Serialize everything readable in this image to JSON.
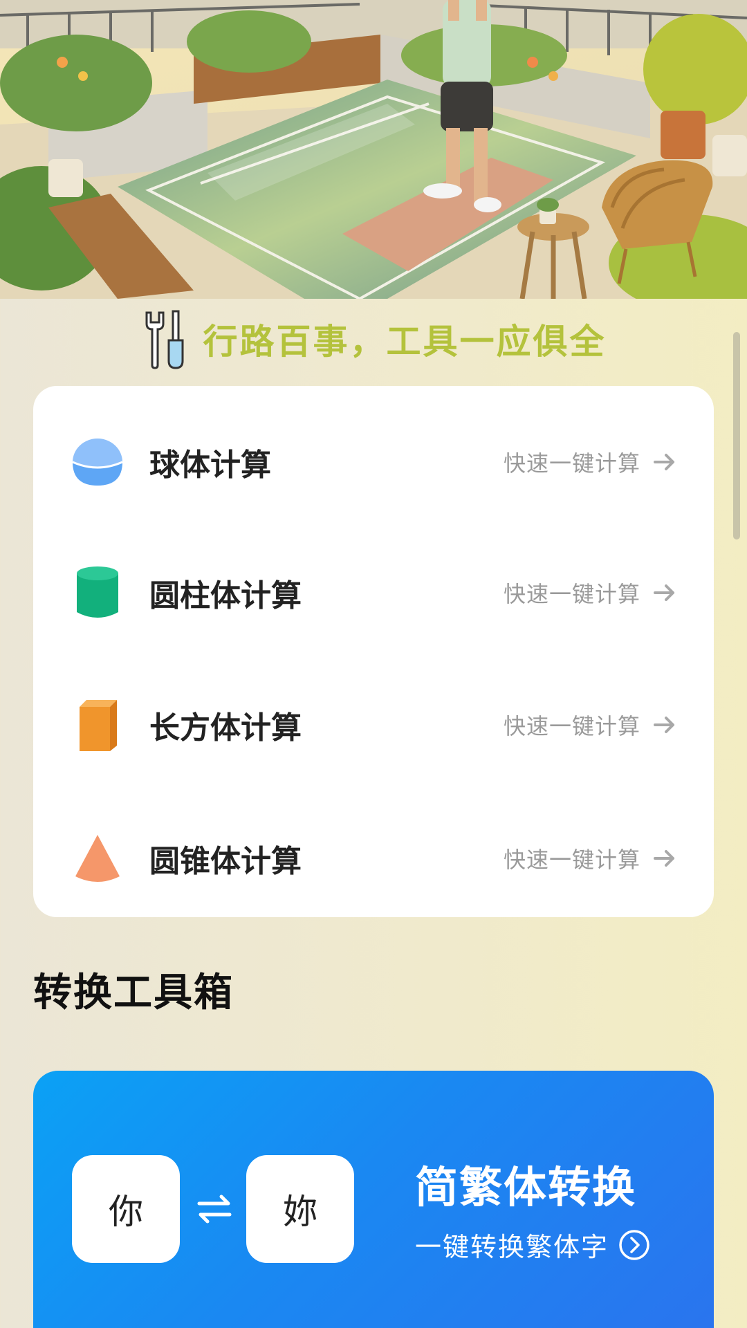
{
  "slogan": {
    "text": "行路百事，工具一应俱全",
    "icon": "tools-icon",
    "color": "#b4c23c"
  },
  "calculators": [
    {
      "title": "球体计算",
      "action": "快速一键计算",
      "icon": "sphere-icon",
      "color": "#6aaef7"
    },
    {
      "title": "圆柱体计算",
      "action": "快速一键计算",
      "icon": "cylinder-icon",
      "color": "#1cb37f"
    },
    {
      "title": "长方体计算",
      "action": "快速一键计算",
      "icon": "cuboid-icon",
      "color": "#f0952c"
    },
    {
      "title": "圆锥体计算",
      "action": "快速一键计算",
      "icon": "cone-icon",
      "color": "#f5976a"
    }
  ],
  "section": {
    "title": "转换工具箱"
  },
  "converter": {
    "from_char": "你",
    "to_char": "妳",
    "title": "简繁体转换",
    "subtitle": "一键转换繁体字",
    "swap_icon": "swap-arrows-icon",
    "go_icon": "chevron-right-circle-icon",
    "gradient_start": "#0ba1f5",
    "gradient_end": "#2b73ee"
  }
}
